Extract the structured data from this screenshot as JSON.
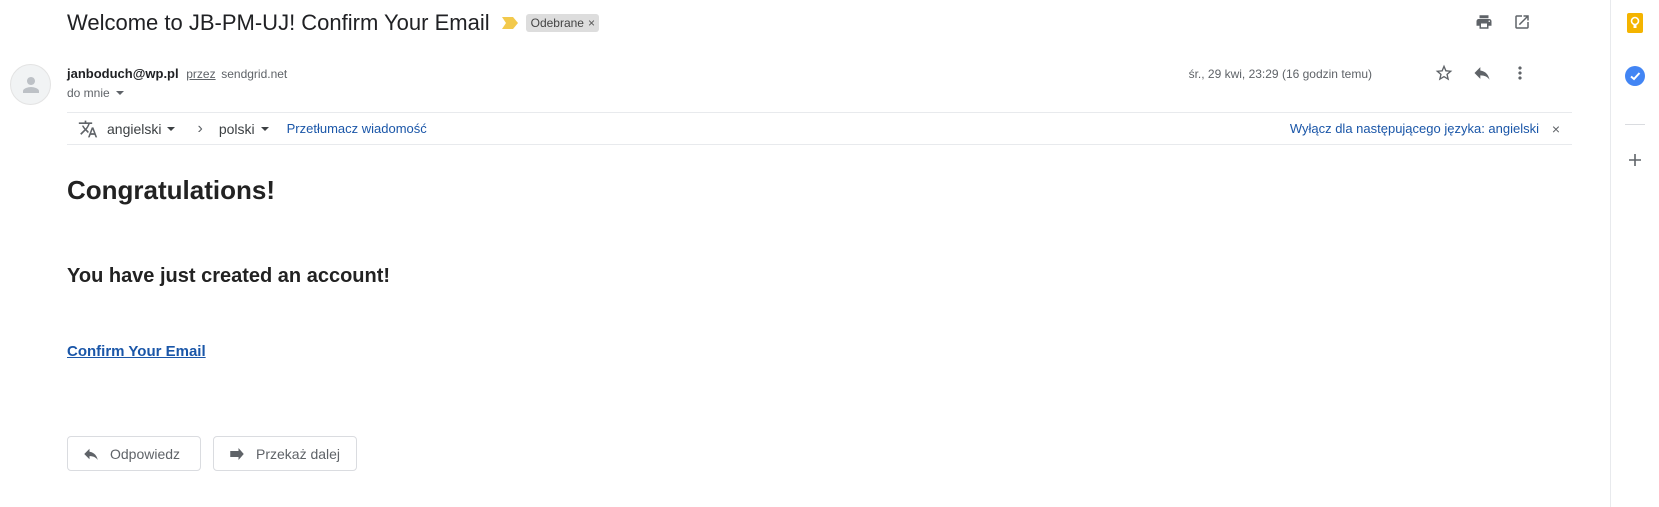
{
  "subject": {
    "title": "Welcome to JB-PM-UJ! Confirm Your Email",
    "label": "Odebrane",
    "label_close": "×"
  },
  "sender": {
    "email": "janboduch@wp.pl",
    "via": "przez",
    "domain": "sendgrid.net",
    "to": "do mnie",
    "date": "śr., 29 kwi, 23:29 (16 godzin temu)"
  },
  "translate": {
    "from_lang": "angielski",
    "to_lang": "polski",
    "translate_label": "Przetłumacz wiadomość",
    "disable_label": "Wyłącz dla następującego języka: angielski",
    "close": "×"
  },
  "body": {
    "heading": "Congratulations!",
    "subheading": "You have just created an account!",
    "link_text": "Confirm Your Email"
  },
  "actions": {
    "reply_label": "Odpowiedz",
    "forward_label": "Przekaż dalej"
  },
  "icons": {
    "top": [
      "print-icon",
      "open-in-new-window-icon"
    ],
    "message": [
      "star-icon",
      "reply-icon",
      "more-vert-icon"
    ],
    "side": [
      "keep-icon",
      "tasks-icon",
      "add-icon"
    ]
  },
  "colors": {
    "link": "#1a56a8",
    "importance": "#f2c94c",
    "keep": "#f4b400",
    "tasks": "#4285f4"
  }
}
